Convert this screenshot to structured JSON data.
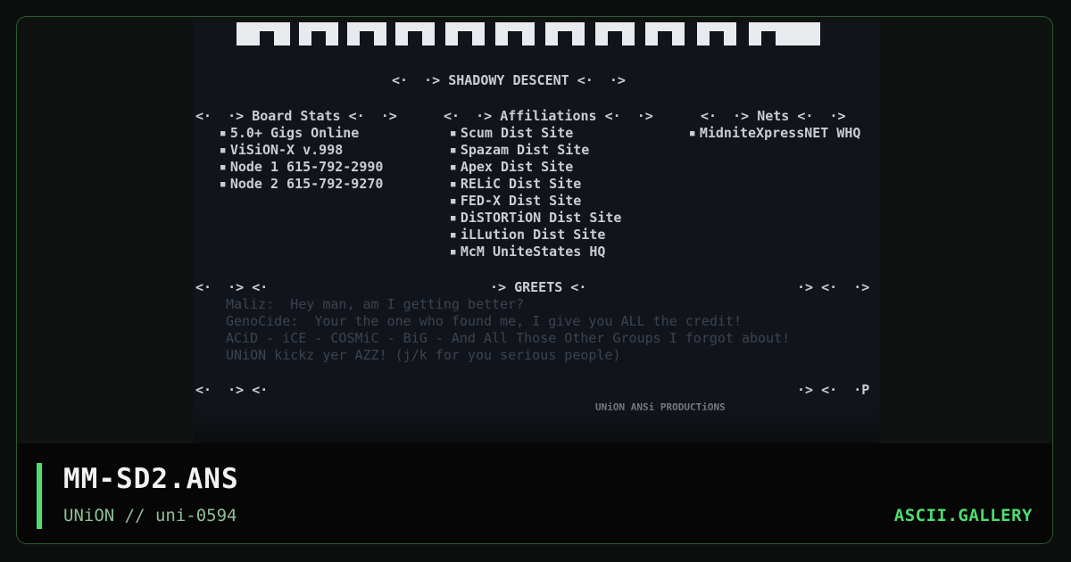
{
  "colors": {
    "accent": "#4fdc72",
    "frame_border": "#2b5a34",
    "ansi_background": "#11151b",
    "ansi_text": "#c9ced6"
  },
  "ansi": {
    "header": "<·  ·> SHADOWY DESCENT <·  ·>",
    "board_stats": {
      "heading": "<·  ·> Board Stats <·  ·>",
      "items": [
        "5.0+ Gigs Online",
        "ViSiON-X v.998",
        "Node 1 615-792-2990",
        "Node 2 615-792-9270"
      ]
    },
    "affiliations": {
      "heading": "<·  ·> Affiliations <·  ·>",
      "items": [
        "Scum Dist Site",
        "Spazam Dist Site",
        "Apex Dist Site",
        "RELiC Dist Site",
        "FED-X Dist Site",
        "DiSTORTiON Dist Site",
        "iLLution Dist Site",
        "McM UniteStates HQ"
      ]
    },
    "nets": {
      "heading": "<·  ·> Nets <·  ·>",
      "items": [
        "MidniteXpressNET WHQ"
      ]
    },
    "greets": {
      "heading_left": "<·  ·> <·",
      "heading": "·> GREETS <·",
      "heading_right": "·> <·  ·>",
      "lines": [
        "Maliz:  Hey man, am I getting better?",
        "GenoCide:  Your the one who found me, I give you ALL the credit!",
        "ACiD - iCE - COSMiC - BiG - And All Those Other Groups I forgot about!",
        "UNiON kickz yer AZZ! (j/k for you serious people)"
      ]
    },
    "bottom_left": "<·  ·> <·",
    "bottom_right": "·> <·  ·P",
    "bottom_partial": "UNiON ANSi PRODUCTiONS"
  },
  "footer": {
    "filename": "MM-SD2.ANS",
    "meta": "UNiON // uni-0594",
    "brand": "ASCII.GALLERY"
  }
}
